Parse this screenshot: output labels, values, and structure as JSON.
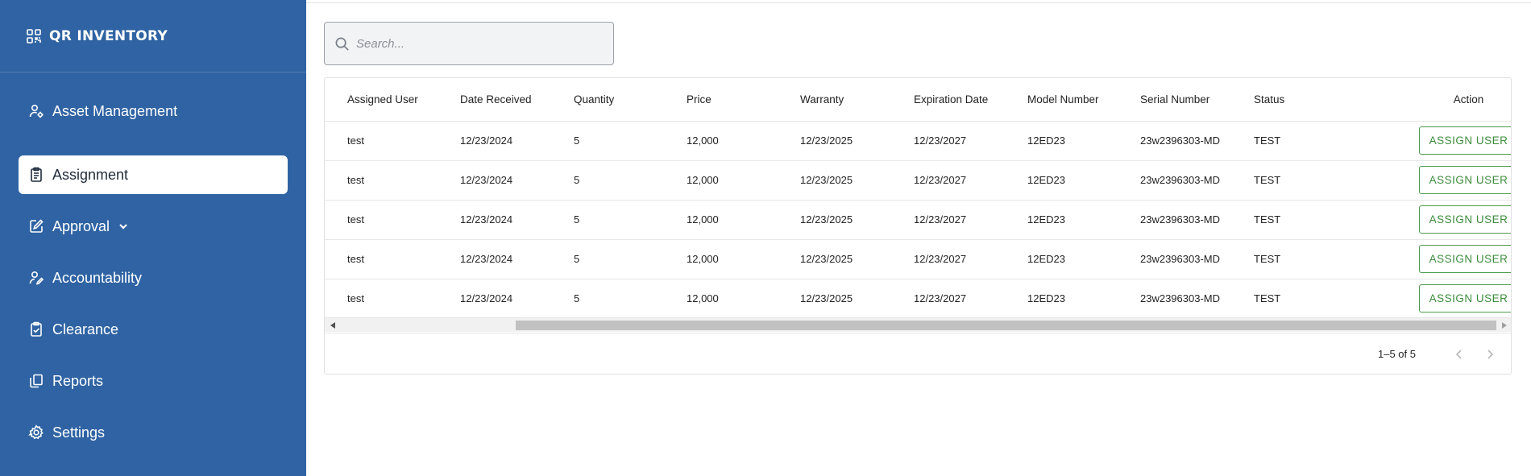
{
  "brand": {
    "title": "QR INVENTORY",
    "icon": "qr-grid-icon"
  },
  "sidebar": {
    "items": [
      {
        "label": "Asset Management",
        "icon": "user-gear-icon",
        "active": false
      },
      {
        "label": "Assignment",
        "icon": "clipboard-list-icon",
        "active": true
      },
      {
        "label": "Approval",
        "icon": "edit-square-icon",
        "active": false,
        "has_submenu": true
      },
      {
        "label": "Accountability",
        "icon": "user-pen-icon",
        "active": false
      },
      {
        "label": "Clearance",
        "icon": "clipboard-check-icon",
        "active": false
      },
      {
        "label": "Reports",
        "icon": "copy-files-icon",
        "active": false
      },
      {
        "label": "Settings",
        "icon": "gear-icon",
        "active": false
      }
    ]
  },
  "search": {
    "placeholder": "Search...",
    "value": ""
  },
  "table": {
    "columns": [
      "Assigned User",
      "Date Received",
      "Quantity",
      "Price",
      "Warranty",
      "Expiration Date",
      "Model Number",
      "Serial Number",
      "Status",
      "Action"
    ],
    "rows": [
      {
        "assigned_user": "test",
        "date_received": "12/23/2024",
        "quantity": "5",
        "price": "12,000",
        "warranty": "12/23/2025",
        "expiration_date": "12/23/2027",
        "model_number": "12ED23",
        "serial_number": "23w2396303-MD",
        "status": "TEST",
        "action": "ASSIGN USER"
      },
      {
        "assigned_user": "test",
        "date_received": "12/23/2024",
        "quantity": "5",
        "price": "12,000",
        "warranty": "12/23/2025",
        "expiration_date": "12/23/2027",
        "model_number": "12ED23",
        "serial_number": "23w2396303-MD",
        "status": "TEST",
        "action": "ASSIGN USER"
      },
      {
        "assigned_user": "test",
        "date_received": "12/23/2024",
        "quantity": "5",
        "price": "12,000",
        "warranty": "12/23/2025",
        "expiration_date": "12/23/2027",
        "model_number": "12ED23",
        "serial_number": "23w2396303-MD",
        "status": "TEST",
        "action": "ASSIGN USER"
      },
      {
        "assigned_user": "test",
        "date_received": "12/23/2024",
        "quantity": "5",
        "price": "12,000",
        "warranty": "12/23/2025",
        "expiration_date": "12/23/2027",
        "model_number": "12ED23",
        "serial_number": "23w2396303-MD",
        "status": "TEST",
        "action": "ASSIGN USER"
      },
      {
        "assigned_user": "test",
        "date_received": "12/23/2024",
        "quantity": "5",
        "price": "12,000",
        "warranty": "12/23/2025",
        "expiration_date": "12/23/2027",
        "model_number": "12ED23",
        "serial_number": "23w2396303-MD",
        "status": "TEST",
        "action": "ASSIGN USER"
      }
    ]
  },
  "pagination": {
    "range_text": "1–5 of 5",
    "prev_icon": "chevron-left-icon",
    "next_icon": "chevron-right-icon"
  },
  "colors": {
    "sidebar_bg": "#2f63a3",
    "active_item_bg": "#ffffff",
    "assign_button": "#3c8c3c"
  }
}
